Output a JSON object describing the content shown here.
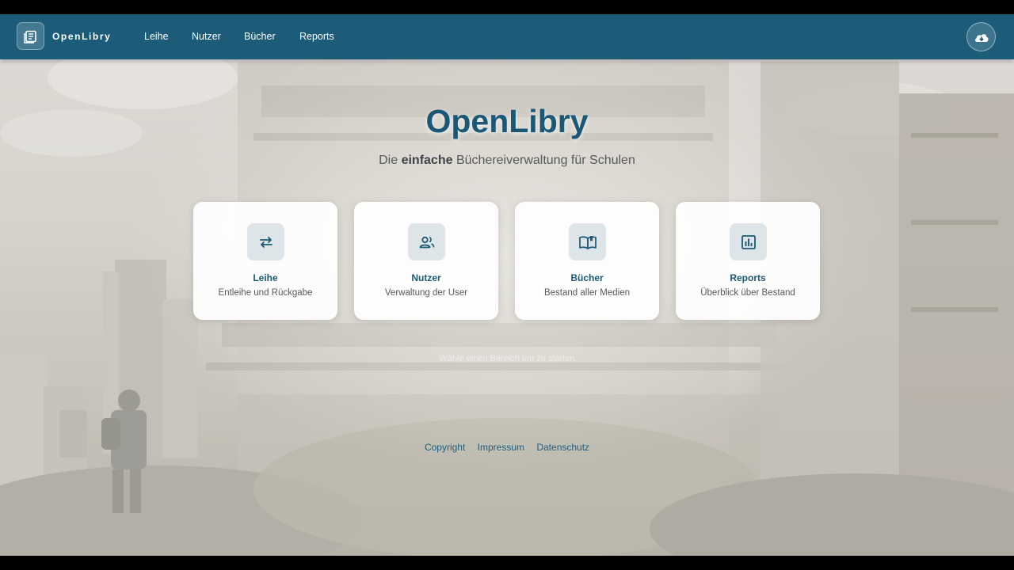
{
  "app": {
    "name": "OpenLibry"
  },
  "nav": {
    "items": [
      {
        "label": "Leihe"
      },
      {
        "label": "Nutzer"
      },
      {
        "label": "Bücher"
      },
      {
        "label": "Reports"
      }
    ],
    "cloud_icon": "cloud-download-icon"
  },
  "hero": {
    "title": "OpenLibry",
    "subtitle_pre": "Die ",
    "subtitle_bold": "einfache",
    "subtitle_post": " Büchereiverwaltung für Schulen"
  },
  "cards": [
    {
      "title": "Leihe",
      "description": "Entleihe und Rückgabe",
      "icon": "swap-arrows-icon"
    },
    {
      "title": "Nutzer",
      "description": "Verwaltung der User",
      "icon": "users-icon"
    },
    {
      "title": "Bücher",
      "description": "Bestand aller Medien",
      "icon": "open-book-icon"
    },
    {
      "title": "Reports",
      "description": "Überblick über Bestand",
      "icon": "bar-chart-icon"
    }
  ],
  "hint": "Wähle einen Bereich um zu starten",
  "footer": {
    "links": [
      {
        "label": "Copyright"
      },
      {
        "label": "Impressum"
      },
      {
        "label": "Datenschutz"
      }
    ]
  },
  "colors": {
    "navbar": "#1c5c79",
    "accent": "#1b5876",
    "card_icon_bg": "#dde5e9"
  }
}
